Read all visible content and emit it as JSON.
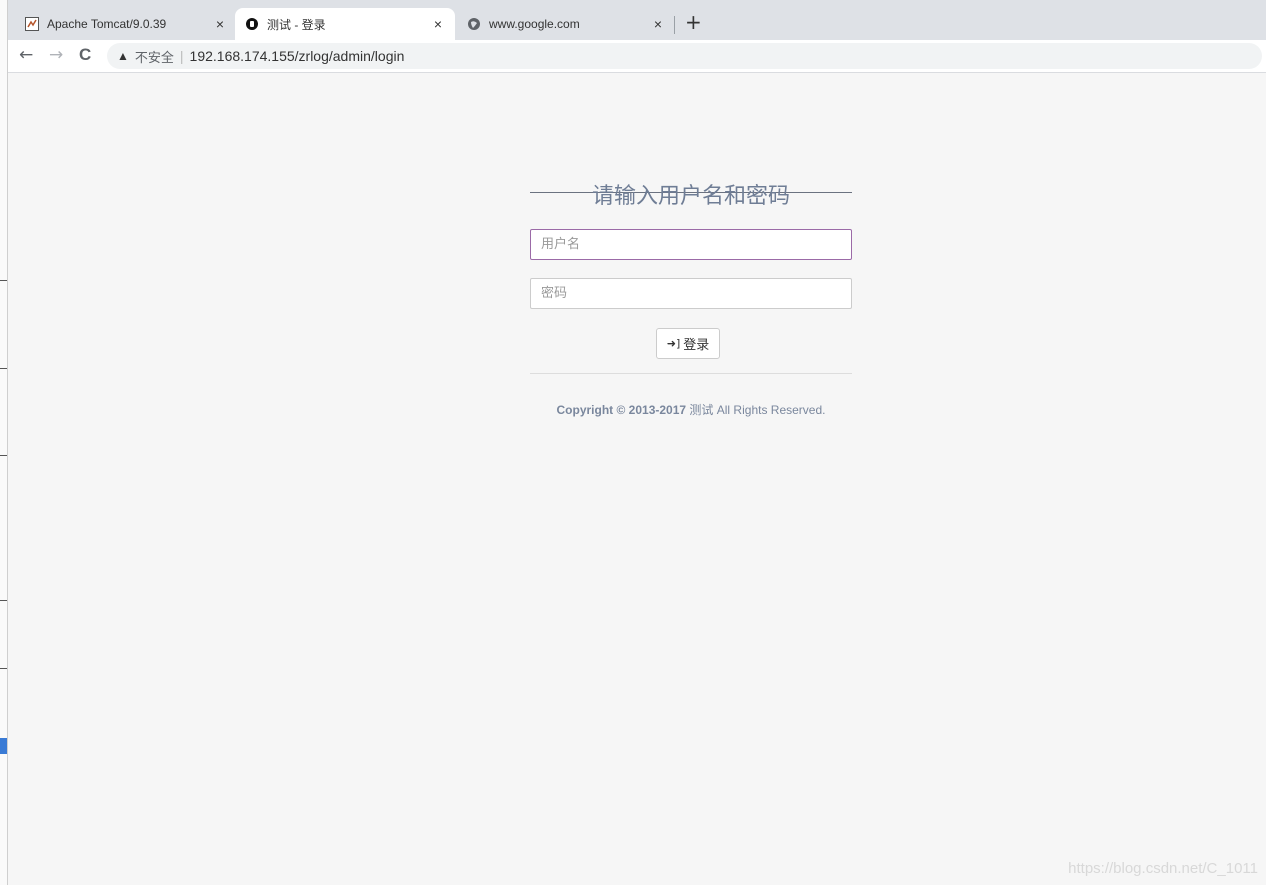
{
  "tabs": [
    {
      "title": "Apache Tomcat/9.0.39",
      "icon": "tomcat-icon",
      "close": "×"
    },
    {
      "title": "测试 - 登录",
      "icon": "site-icon",
      "close": "×"
    },
    {
      "title": "www.google.com",
      "icon": "globe-icon",
      "close": "×"
    }
  ],
  "toolbar": {
    "back": "←",
    "forward": "→",
    "reload": "C",
    "warning": "▲",
    "insecure_label": "不安全",
    "url": "192.168.174.155/zrlog/admin/login",
    "newtab": "+"
  },
  "login": {
    "heading": "请输入用户名和密码",
    "username_placeholder": "用户名",
    "password_placeholder": "密码",
    "submit_label": "登录",
    "copyright_prefix": "Copyright © 2013-2017",
    "copyright_site": "测试",
    "copyright_suffix": "All Rights Reserved."
  },
  "watermark": "https://blog.csdn.net/C_1011"
}
